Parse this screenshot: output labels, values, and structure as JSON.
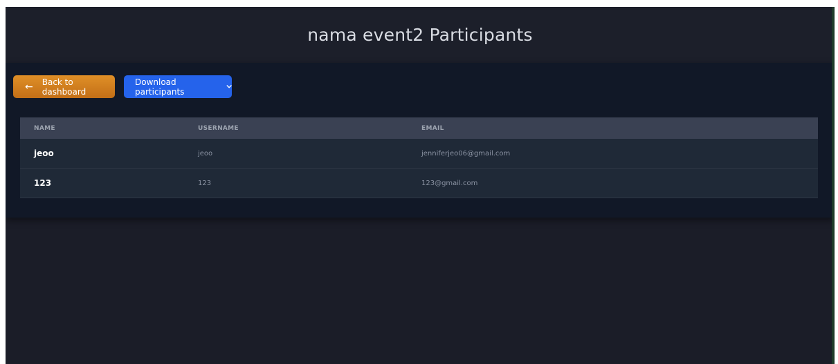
{
  "header": {
    "title": "nama event2 Participants"
  },
  "toolbar": {
    "back_arrow": "←",
    "back_label": "Back to dashboard",
    "download_label": "Download participants",
    "download_icon": "chevron-down-icon"
  },
  "table": {
    "columns": [
      "NAME",
      "USERNAME",
      "EMAIL"
    ],
    "rows": [
      {
        "name": "jeoo",
        "username": "jeoo",
        "email": "jenniferjeo06@gmail.com"
      },
      {
        "name": "123",
        "username": "123",
        "email": "123@gmail.com"
      }
    ]
  },
  "colors": {
    "back_button": "#d4801f",
    "download_button": "#2563eb",
    "panel_bg": "#111827",
    "page_bg": "#1b1d28"
  }
}
